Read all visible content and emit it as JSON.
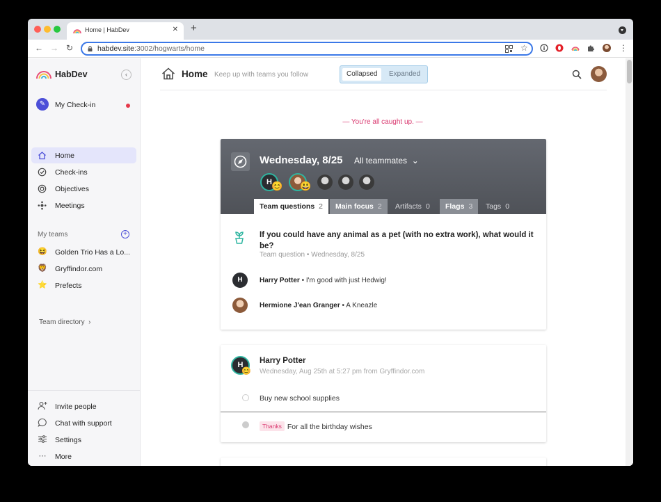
{
  "browser": {
    "tab_title": "Home | HabDev",
    "tab_close": "✕",
    "new_tab": "+",
    "url_host": "habdev.site",
    "url_path": ":3002/hogwarts/home",
    "back": "←",
    "forward": "→",
    "reload": "↻",
    "star": "☆",
    "menu": "⋮"
  },
  "sidebar": {
    "brand": "HabDev",
    "collapse": "‹",
    "checkin_label": "My Check-in",
    "nav": [
      {
        "label": "Home",
        "icon": "home-icon",
        "glyph": "⌂"
      },
      {
        "label": "Check-ins",
        "icon": "check-circle-icon",
        "glyph": "✓"
      },
      {
        "label": "Objectives",
        "icon": "target-icon",
        "glyph": "◎"
      },
      {
        "label": "Meetings",
        "icon": "meetings-icon",
        "glyph": "✥"
      }
    ],
    "teams_label": "My teams",
    "add_team": "+",
    "teams": [
      {
        "label": "Golden Trio Has a Lo...",
        "emoji": "😆"
      },
      {
        "label": "Gryffindor.com",
        "emoji": "🦁"
      },
      {
        "label": "Prefects",
        "emoji": "⭐"
      }
    ],
    "team_directory": "Team directory",
    "team_directory_chevron": "›",
    "bottom": [
      {
        "label": "Invite people",
        "icon": "invite-person-icon",
        "glyph": "👤"
      },
      {
        "label": "Chat with support",
        "icon": "chat-bubble-icon",
        "glyph": "💬"
      },
      {
        "label": "Settings",
        "icon": "sliders-icon",
        "glyph": "☰"
      },
      {
        "label": "More",
        "icon": "more-dots-icon",
        "glyph": "⋯"
      }
    ]
  },
  "header": {
    "title": "Home",
    "subtitle": "Keep up with teams you follow",
    "toggle": [
      "Collapsed",
      "Expanded"
    ],
    "toggle_selected": "Collapsed"
  },
  "feed": {
    "caught_up": "— You're all caught up. —",
    "day_card": {
      "date": "Wednesday, 8/25",
      "filter": "All teammates",
      "filter_chevron": "⌄",
      "avatars": [
        {
          "initial": "H",
          "emoji": "😊"
        },
        {
          "initial": "",
          "emoji": "😃"
        }
      ],
      "tabs": [
        {
          "label": "Team questions",
          "count": "2"
        },
        {
          "label": "Main focus",
          "count": "2"
        },
        {
          "label": "Artifacts",
          "count": "0"
        },
        {
          "label": "Flags",
          "count": "3"
        },
        {
          "label": "Tags",
          "count": "0"
        }
      ],
      "question": "If you could have any animal as a pet (with no extra work), what would it be?",
      "question_meta": "Team question • Wednesday, 8/25",
      "answers": [
        {
          "name": "Harry Potter",
          "initial": "H",
          "text": " • I'm good with just Hedwig!"
        },
        {
          "name": "Hermione J'ean Granger",
          "initial": "",
          "text": " • A Kneazle"
        }
      ]
    },
    "checkin_card": {
      "initial": "H",
      "emoji": "😊",
      "name": "Harry Potter",
      "meta": "Wednesday, Aug 25th at 5:27 pm from Gryffindor.com",
      "tasks": [
        {
          "label": "Buy new school supplies",
          "done": false,
          "badge": ""
        },
        {
          "label": "For all the birthday wishes",
          "done": true,
          "badge": "Thanks"
        }
      ]
    }
  },
  "colors": {
    "accent": "#4c4fd8",
    "teal": "#2fb5a1",
    "pink": "#d9386f",
    "notification": "#e5384a"
  }
}
